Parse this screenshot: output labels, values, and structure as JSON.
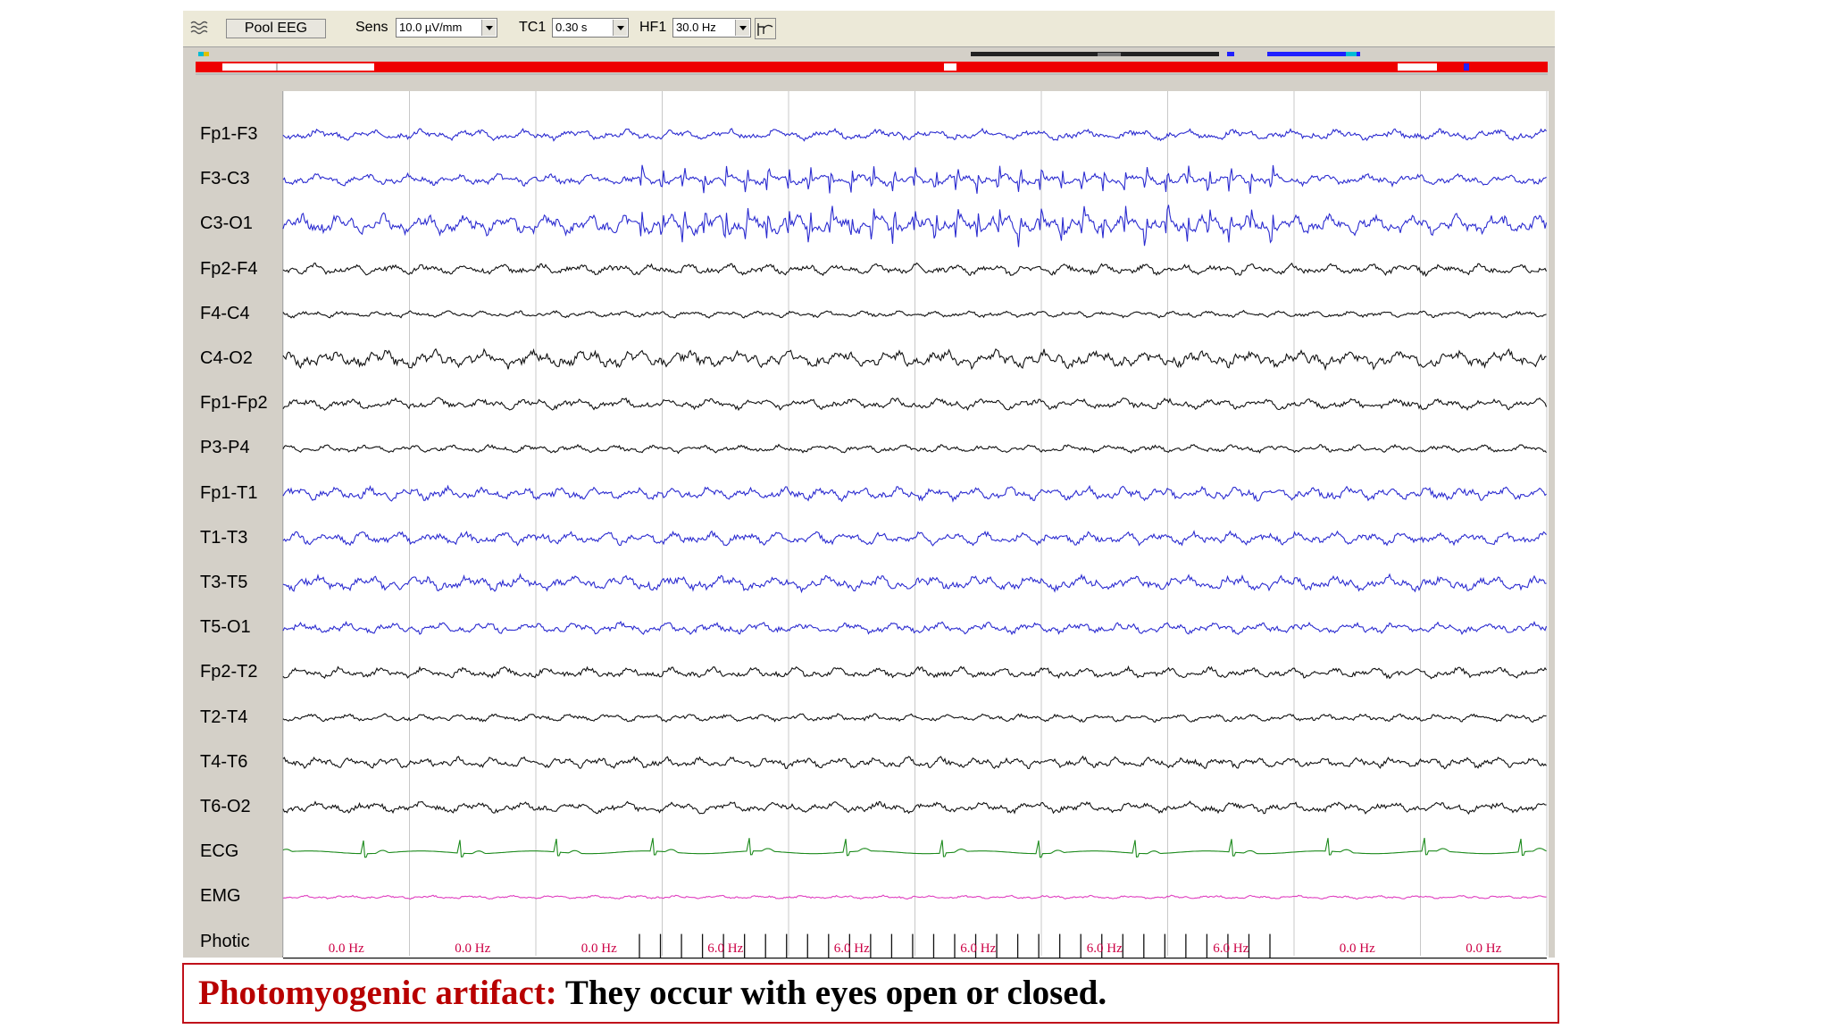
{
  "toolbar": {
    "montage_button": "Pool EEG",
    "sens_label": "Sens",
    "sens_value": "10.0 µV/mm",
    "tc_label": "TC1",
    "tc_value": "0.30 s",
    "hf_label": "HF1",
    "hf_value": "30.0 Hz",
    "app_icon": "waveform-icon",
    "filter_icon": "filter-response-icon"
  },
  "channels": [
    {
      "name": "Fp1-F3",
      "color": "#2b2bd0"
    },
    {
      "name": "F3-C3",
      "color": "#2b2bd0"
    },
    {
      "name": "C3-O1",
      "color": "#2b2bd0"
    },
    {
      "name": "Fp2-F4",
      "color": "#111111"
    },
    {
      "name": "F4-C4",
      "color": "#111111"
    },
    {
      "name": "C4-O2",
      "color": "#111111"
    },
    {
      "name": "Fp1-Fp2",
      "color": "#111111"
    },
    {
      "name": "P3-P4",
      "color": "#111111"
    },
    {
      "name": "Fp1-T1",
      "color": "#2b2bd0"
    },
    {
      "name": "T1-T3",
      "color": "#2b2bd0"
    },
    {
      "name": "T3-T5",
      "color": "#2b2bd0"
    },
    {
      "name": "T5-O1",
      "color": "#2b2bd0"
    },
    {
      "name": "Fp2-T2",
      "color": "#111111"
    },
    {
      "name": "T2-T4",
      "color": "#111111"
    },
    {
      "name": "T4-T6",
      "color": "#111111"
    },
    {
      "name": "T6-O2",
      "color": "#111111"
    },
    {
      "name": "ECG",
      "color": "#1c8a1c"
    },
    {
      "name": "EMG",
      "color": "#e040c0"
    },
    {
      "name": "Photic",
      "color": "#111111"
    }
  ],
  "photic_frequencies": [
    "0.0 Hz",
    "0.0 Hz",
    "0.0 Hz",
    "6.0 Hz",
    "6.0 Hz",
    "6.0 Hz",
    "6.0 Hz",
    "6.0 Hz",
    "0.0 Hz",
    "0.0 Hz"
  ],
  "photic_flashes": 31,
  "caption": {
    "highlight": "Photomyogenic artifact:",
    "text": " They occur with eyes open or closed."
  },
  "colors": {
    "timeline_red": "#ee0000",
    "timeline_blue": "#2020ff",
    "caption_border": "#c0101a",
    "caption_highlight": "#b80000",
    "hz_label": "#cc0044"
  }
}
